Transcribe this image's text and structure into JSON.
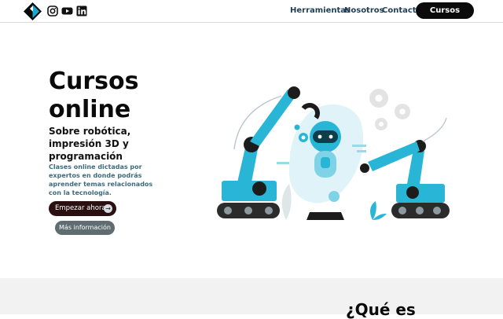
{
  "header": {
    "nav": [
      {
        "label": "Herramientas"
      },
      {
        "label": "Nosotros"
      },
      {
        "label": "Contacto"
      }
    ],
    "cta_label": "Cursos",
    "social_icons": [
      "instagram-icon",
      "youtube-icon",
      "linkedin-icon"
    ]
  },
  "hero": {
    "title_line1": "Cursos",
    "title_line2": "online",
    "subtitle": "Sobre robótica, impresión 3D y programación",
    "description": "Clases online dictadas por expertos en donde podrás aprender temas relacionados con la tecnología.",
    "primary_button": "Empezar ahora",
    "primary_button_icon": "→",
    "secondary_button": "Más información"
  },
  "section": {
    "title": "¿Qué es"
  },
  "colors": {
    "accent": "#29b6d6",
    "dark_button": "#2a1010",
    "nav_text": "#1d3f55",
    "secondary_button": "#5f6d73"
  }
}
